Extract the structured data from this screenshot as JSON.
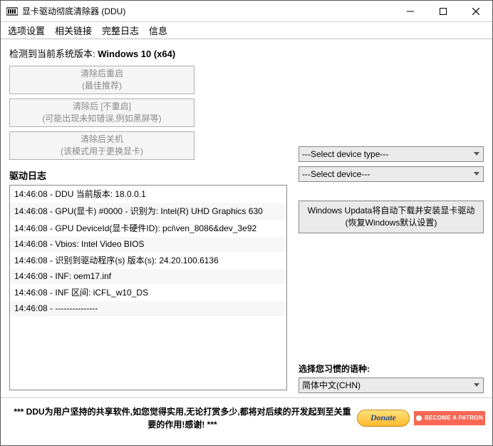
{
  "window": {
    "title": "显卡驱动彻底清除器 (DDU)"
  },
  "menu": {
    "options": "选项设置",
    "links": "相关链接",
    "log": "完整日志",
    "info": "信息"
  },
  "system": {
    "label": "检测到当前系统版本:",
    "value": "Windows 10 (x64)"
  },
  "buttons": {
    "clean_restart_l1": "清除后重启",
    "clean_restart_l2": "(最佳推荐)",
    "clean_norestart_l1": "清除后 [不重启]",
    "clean_norestart_l2": "(可能出现未知错误,例如黑屏等)",
    "clean_shutdown_l1": "清除后关机",
    "clean_shutdown_l2": "(该模式用于更换显卡)"
  },
  "log": {
    "header": "驱动日志",
    "lines": [
      "14:46:08 - DDU 当前版本: 18.0.0.1",
      "14:46:08 - GPU(显卡) #0000 - 识别为: Intel(R) UHD Graphics 630",
      "14:46:08 - GPU DeviceId(显卡硬件ID): pci\\ven_8086&dev_3e92",
      "14:46:08 - Vbios: Intel Video BIOS",
      "14:46:08 - 识别到驱动程序(s) 版本(s): 24.20.100.6136",
      "14:46:08 - INF: oem17.inf",
      "14:46:08 - INF 区间: iCFL_w10_DS",
      "14:46:08 - ---------------"
    ]
  },
  "right": {
    "device_type_placeholder": "---Select device type---",
    "device_placeholder": "---Select device---",
    "restore_l1": "Windows Updata将自动下载并安装显卡驱动",
    "restore_l2": "(恢复Windows默认设置)",
    "lang_label": "选择您习惯的语种:",
    "lang_value": "简体中文(CHN)"
  },
  "footer": {
    "msg": "*** DDU为用户坚持的共享软件,如您觉得实用,无论打赏多少,都将对后续的开发起到至关重要的作用!感谢! ***",
    "donate": "Donate",
    "patreon": "BECOME A PATRON"
  }
}
